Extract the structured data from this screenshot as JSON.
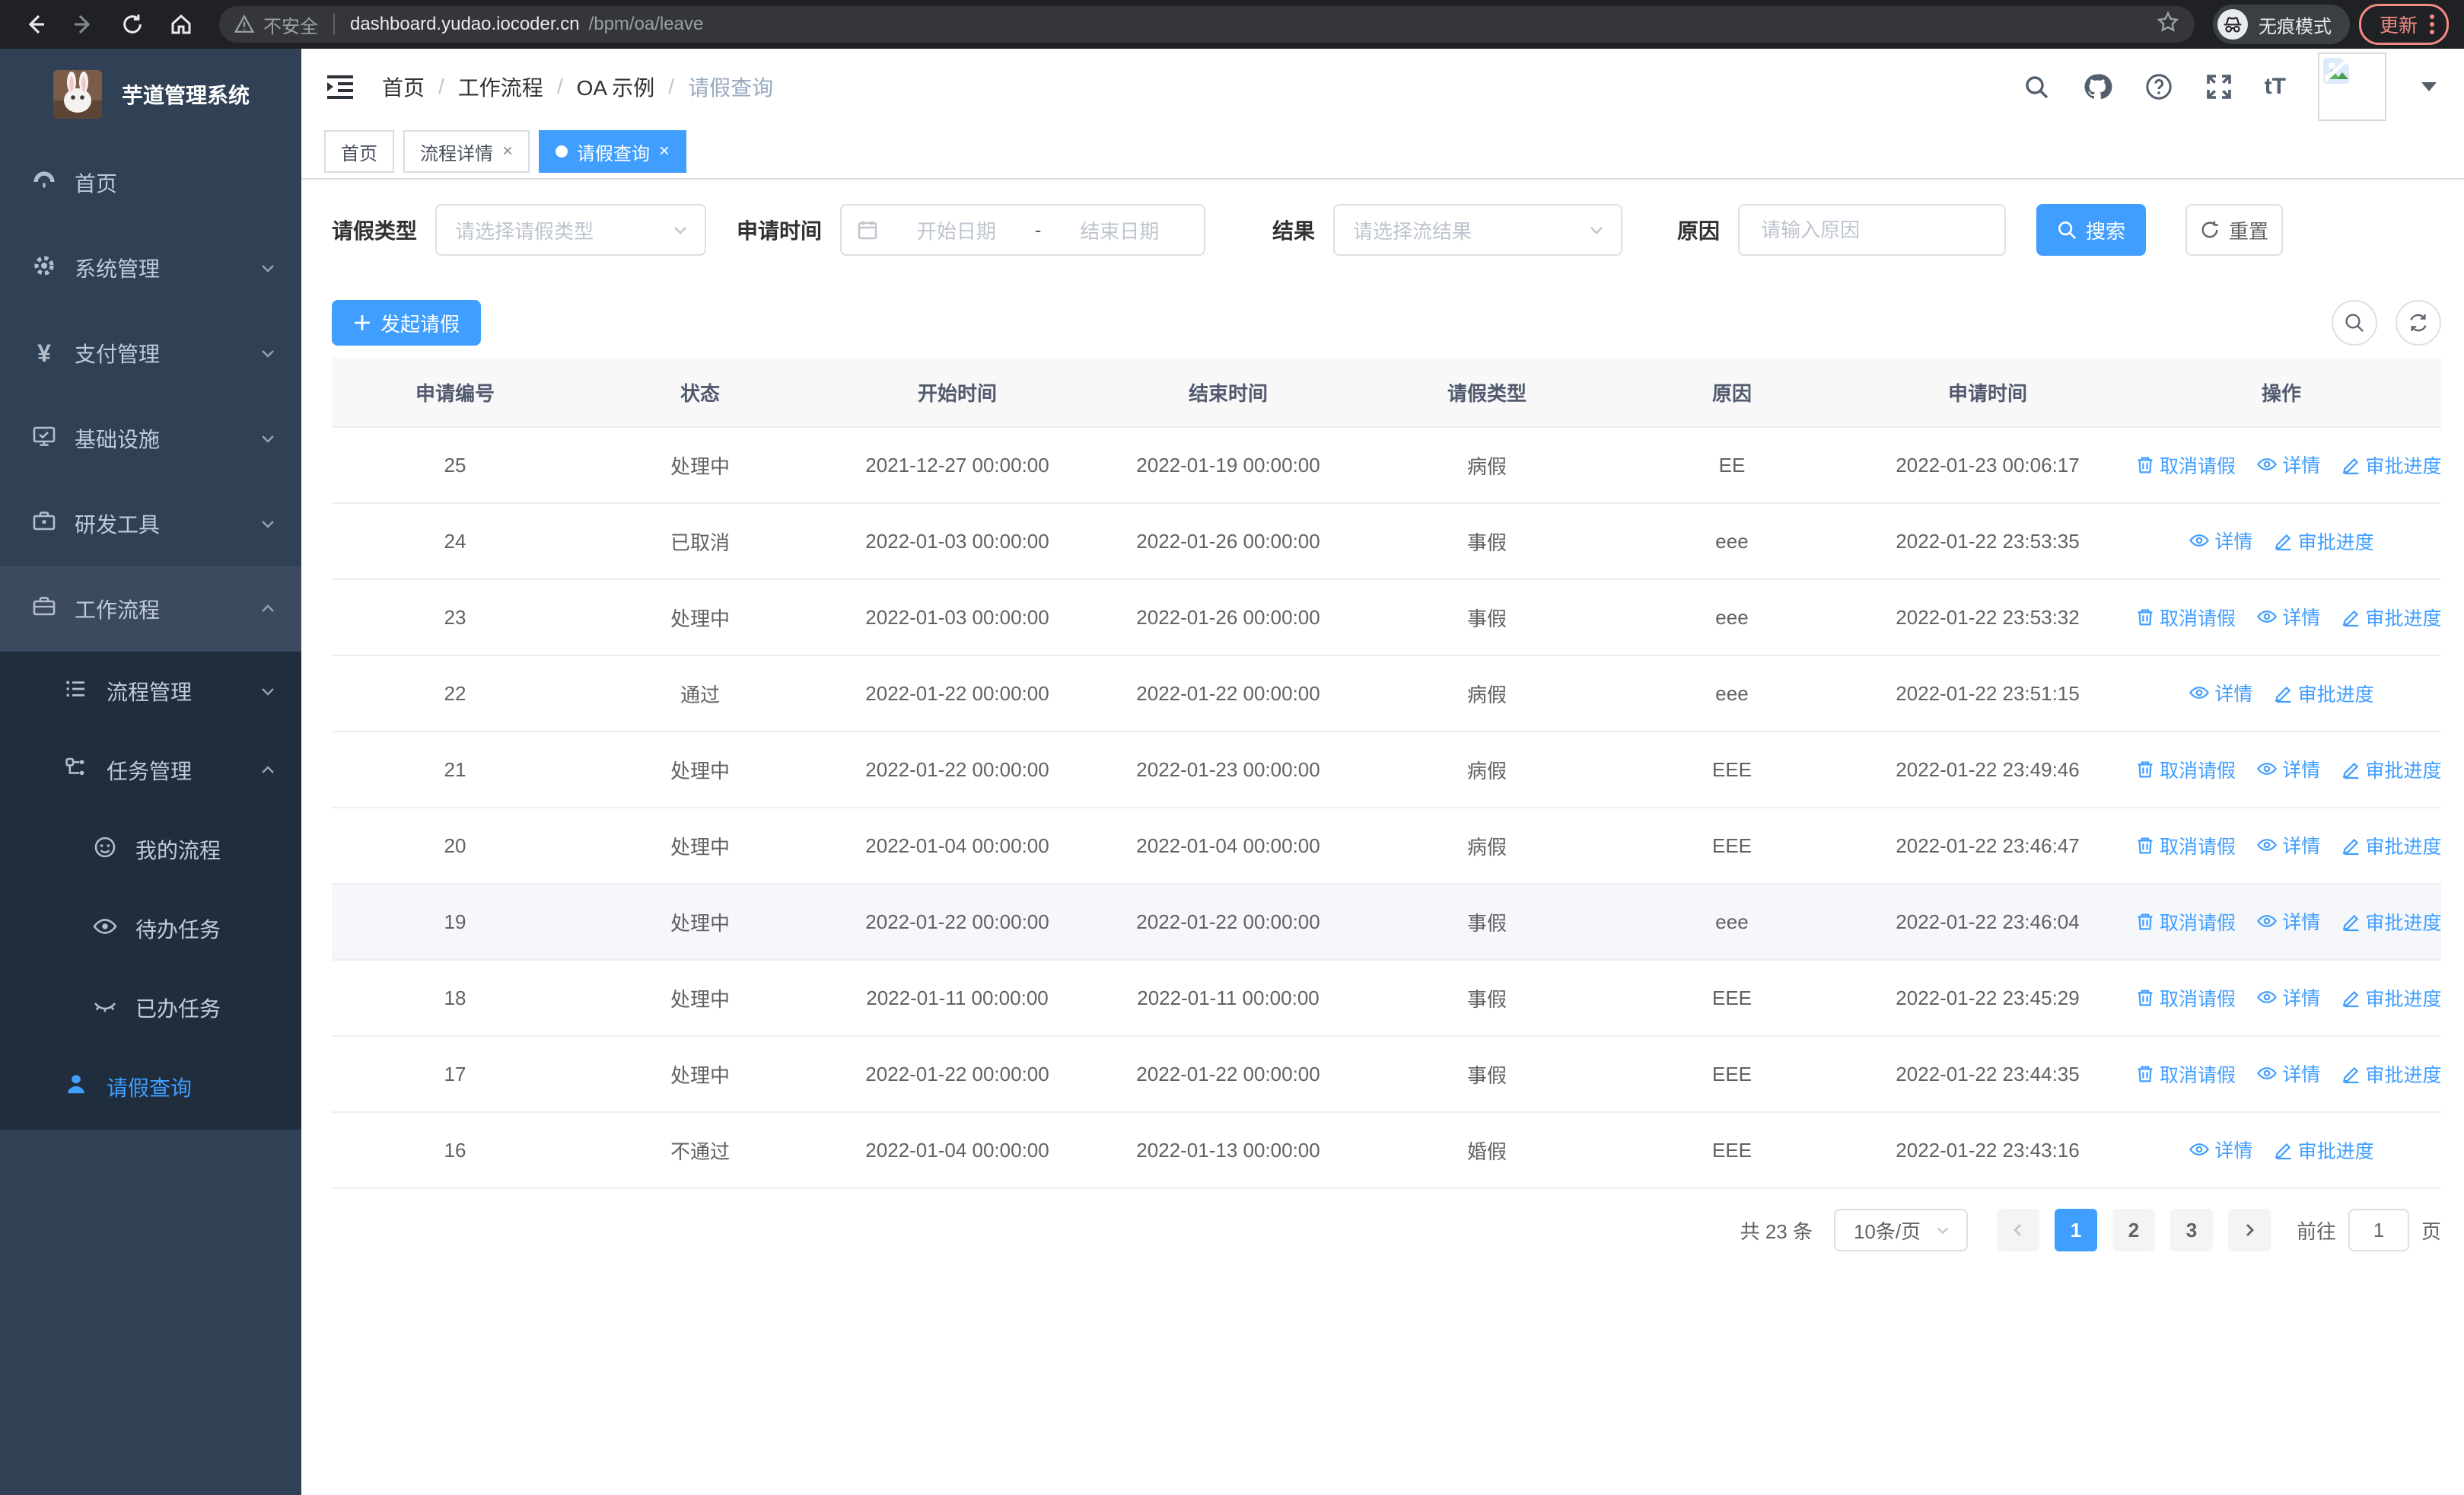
{
  "colors": {
    "accent": "#409eff",
    "sidebar_bg": "#304156",
    "sidebar_submenu_bg": "#1f2d3d",
    "update_button": "#f28b82",
    "table_header_bg": "#f8f8f9"
  },
  "browser": {
    "security_label": "不安全",
    "url_host": "dashboard.yudao.iocoder.cn",
    "url_path": "/bpm/oa/leave",
    "incognito_label": "无痕模式",
    "update_label": "更新"
  },
  "sidebar": {
    "app_title": "芋道管理系统",
    "items": [
      {
        "label": "首页"
      },
      {
        "label": "系统管理"
      },
      {
        "label": "支付管理"
      },
      {
        "label": "基础设施"
      },
      {
        "label": "研发工具"
      },
      {
        "label": "工作流程"
      }
    ],
    "submenu": {
      "process_mgmt": "流程管理",
      "task_mgmt": "任务管理",
      "my_process": "我的流程",
      "todo_tasks": "待办任务",
      "done_tasks": "已办任务",
      "leave_query": "请假查询"
    }
  },
  "breadcrumb": {
    "separator": "/",
    "items": [
      "首页",
      "工作流程",
      "OA 示例",
      "请假查询"
    ]
  },
  "tabs": [
    {
      "label": "首页",
      "closable": false,
      "active": false
    },
    {
      "label": "流程详情",
      "closable": true,
      "active": false
    },
    {
      "label": "请假查询",
      "closable": true,
      "active": true
    }
  ],
  "filters": {
    "leave_type_label": "请假类型",
    "leave_type_placeholder": "请选择请假类型",
    "apply_time_label": "申请时间",
    "date_start_placeholder": "开始日期",
    "date_separator": "-",
    "date_end_placeholder": "结束日期",
    "result_label": "结果",
    "result_placeholder": "请选择流结果",
    "reason_label": "原因",
    "reason_placeholder": "请输入原因",
    "search_label": "搜索",
    "reset_label": "重置"
  },
  "toolbar": {
    "create_label": "发起请假"
  },
  "table": {
    "headers": [
      "申请编号",
      "状态",
      "开始时间",
      "结束时间",
      "请假类型",
      "原因",
      "申请时间",
      "操作"
    ],
    "action_labels": {
      "cancel": "取消请假",
      "detail": "详情",
      "progress": "审批进度"
    },
    "rows": [
      {
        "id": "25",
        "status": "处理中",
        "start": "2021-12-27 00:00:00",
        "end": "2022-01-19 00:00:00",
        "type": "病假",
        "reason": "EE",
        "applied": "2022-01-23 00:06:17",
        "cancel": true,
        "highlighted": false
      },
      {
        "id": "24",
        "status": "已取消",
        "start": "2022-01-03 00:00:00",
        "end": "2022-01-26 00:00:00",
        "type": "事假",
        "reason": "eee",
        "applied": "2022-01-22 23:53:35",
        "cancel": false,
        "highlighted": false
      },
      {
        "id": "23",
        "status": "处理中",
        "start": "2022-01-03 00:00:00",
        "end": "2022-01-26 00:00:00",
        "type": "事假",
        "reason": "eee",
        "applied": "2022-01-22 23:53:32",
        "cancel": true,
        "highlighted": false
      },
      {
        "id": "22",
        "status": "通过",
        "start": "2022-01-22 00:00:00",
        "end": "2022-01-22 00:00:00",
        "type": "病假",
        "reason": "eee",
        "applied": "2022-01-22 23:51:15",
        "cancel": false,
        "highlighted": false
      },
      {
        "id": "21",
        "status": "处理中",
        "start": "2022-01-22 00:00:00",
        "end": "2022-01-23 00:00:00",
        "type": "病假",
        "reason": "EEE",
        "applied": "2022-01-22 23:49:46",
        "cancel": true,
        "highlighted": false
      },
      {
        "id": "20",
        "status": "处理中",
        "start": "2022-01-04 00:00:00",
        "end": "2022-01-04 00:00:00",
        "type": "病假",
        "reason": "EEE",
        "applied": "2022-01-22 23:46:47",
        "cancel": true,
        "highlighted": false
      },
      {
        "id": "19",
        "status": "处理中",
        "start": "2022-01-22 00:00:00",
        "end": "2022-01-22 00:00:00",
        "type": "事假",
        "reason": "eee",
        "applied": "2022-01-22 23:46:04",
        "cancel": true,
        "highlighted": true
      },
      {
        "id": "18",
        "status": "处理中",
        "start": "2022-01-11 00:00:00",
        "end": "2022-01-11 00:00:00",
        "type": "事假",
        "reason": "EEE",
        "applied": "2022-01-22 23:45:29",
        "cancel": true,
        "highlighted": false
      },
      {
        "id": "17",
        "status": "处理中",
        "start": "2022-01-22 00:00:00",
        "end": "2022-01-22 00:00:00",
        "type": "事假",
        "reason": "EEE",
        "applied": "2022-01-22 23:44:35",
        "cancel": true,
        "highlighted": false
      },
      {
        "id": "16",
        "status": "不通过",
        "start": "2022-01-04 00:00:00",
        "end": "2022-01-13 00:00:00",
        "type": "婚假",
        "reason": "EEE",
        "applied": "2022-01-22 23:43:16",
        "cancel": false,
        "highlighted": false
      }
    ]
  },
  "pagination": {
    "total_label": "共 23 条",
    "page_size": "10条/页",
    "pages": [
      "1",
      "2",
      "3"
    ],
    "current_page": "1",
    "goto_label": "前往",
    "goto_value": "1",
    "goto_suffix": "页"
  }
}
